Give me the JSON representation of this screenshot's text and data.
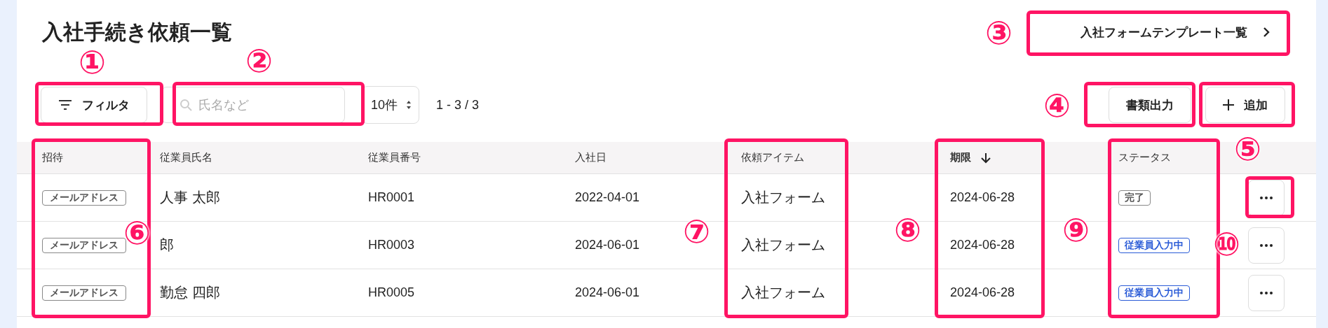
{
  "title": "入社手続き依頼一覧",
  "template_button": {
    "label": "入社フォームテンプレート一覧"
  },
  "filter_button": {
    "label": "フィルタ"
  },
  "search": {
    "placeholder": "氏名など"
  },
  "page_size": {
    "value": "10件"
  },
  "range": "1 - 3 / 3",
  "actions": [
    {
      "label": "書類出力",
      "kind": "plain"
    },
    {
      "label": "追加",
      "kind": "add"
    }
  ],
  "table": {
    "columns": [
      {
        "label": "招待",
        "sorted": false
      },
      {
        "label": "従業員氏名",
        "sorted": false
      },
      {
        "label": "従業員番号",
        "sorted": false
      },
      {
        "label": "入社日",
        "sorted": false
      },
      {
        "label": "依頼アイテム",
        "sorted": false
      },
      {
        "label": "期限",
        "sorted": true
      },
      {
        "label": "ステータス",
        "sorted": false
      }
    ],
    "rows": [
      {
        "invite": "メールアドレス",
        "name": "人事 太郎",
        "number": "HR0001",
        "joined": "2022-04-01",
        "item": "入社フォーム",
        "due": "2024-06-28",
        "status": {
          "label": "完了",
          "kind": "done"
        }
      },
      {
        "invite": "メールアドレス",
        "name": "郎",
        "number": "HR0003",
        "joined": "2024-06-01",
        "item": "入社フォーム",
        "due": "2024-06-28",
        "status": {
          "label": "従業員入力中",
          "kind": "active"
        }
      },
      {
        "invite": "メールアドレス",
        "name": "勤怠 四郎",
        "number": "HR0005",
        "joined": "2024-06-01",
        "item": "入社フォーム",
        "due": "2024-06-28",
        "status": {
          "label": "従業員入力中",
          "kind": "active"
        }
      }
    ]
  },
  "annotations": [
    "①",
    "②",
    "③",
    "④",
    "⑤",
    "⑥",
    "⑦",
    "⑧",
    "⑨",
    "⑩"
  ]
}
